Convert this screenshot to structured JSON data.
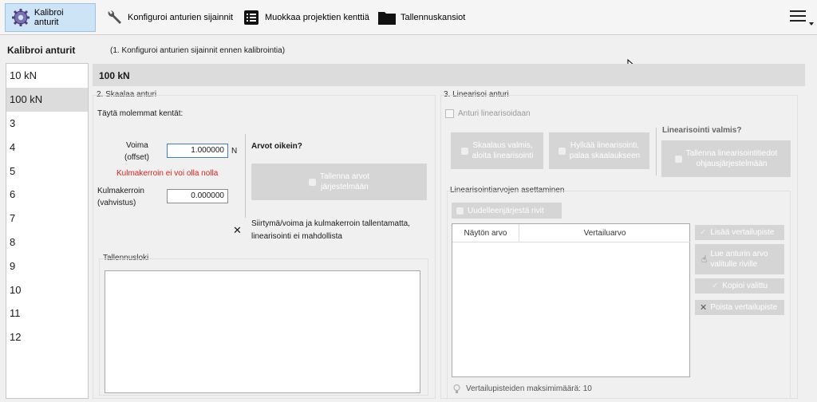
{
  "toolbar": {
    "items": [
      {
        "label": "Kalibroi anturit",
        "icon": "gears-icon"
      },
      {
        "label": "Konfiguroi anturien sijainnit",
        "icon": "wrench-icon"
      },
      {
        "label": "Muokkaa projektien kenttiä",
        "icon": "list-icon"
      },
      {
        "label": "Tallennuskansiot",
        "icon": "folder-icon"
      }
    ],
    "menu_icon": "hamburger-menu-icon"
  },
  "header": {
    "title": "Kalibroi anturit",
    "hint": "(1. Konfiguroi anturien sijainnit ennen kalibrointia)"
  },
  "sensors": {
    "items": [
      "10 kN",
      "100 kN",
      "3",
      "4",
      "5",
      "6",
      "7",
      "8",
      "9",
      "10",
      "11",
      "12"
    ],
    "selected": "100 kN"
  },
  "scale": {
    "section_title": "2. Skaalaa anturi",
    "instruction": "Täytä molemmat kentät:",
    "offset_label_1": "Voima",
    "offset_label_2": "(offset)",
    "offset_value": "1.000000",
    "offset_unit": "N",
    "error": "Kulmakerroin ei voi olla nolla",
    "gain_label_1": "Kulmakerroin",
    "gain_label_2": "(vahvistus)",
    "gain_value": "0.000000",
    "correct_q": "Arvot oikein?",
    "save_btn_1": "Tallenna arvot",
    "save_btn_2": "järjestelmään",
    "status_icon": "cross-icon",
    "status_text_1": "Siirtymä/voima ja kulmakerroin tallentamatta,",
    "status_text_2": "linearisointi ei mahdollista",
    "log_title": "Tallennusloki"
  },
  "linearize": {
    "section_title": "3. Linearisoi anturi",
    "checkbox_label": "Anturi linearisoidaan",
    "btn_scale_done_1": "Skaalaus valmis,",
    "btn_scale_done_2": "aloita linearisointi",
    "btn_reject_1": "Hylkää linearisointi,",
    "btn_reject_2": "palaa skaalaukseen",
    "ready_q": "Linearisointi valmis?",
    "btn_save_1": "Tallenna linearisointitiedot",
    "btn_save_2": "ohjausjärjestelmään",
    "values_title": "Linearisointiarvojen asettaminen",
    "reorder_btn": "Uudelleenjärjestä rivit",
    "col_sample": "Näytön arvo",
    "col_ref": "Vertailuarvo",
    "add_btn": "Lisää vertailupiste",
    "read_btn_1": "Lue anturin arvo",
    "read_btn_2": "valitulle riville",
    "copy_btn": "Kopioi valittu",
    "remove_btn": "Poista vertailupiste",
    "max_points": "Vertailupisteiden maksimimäärä: 10"
  }
}
